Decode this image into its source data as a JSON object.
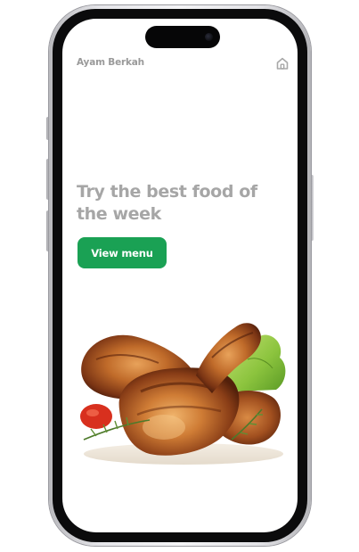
{
  "app": {
    "brand": "Ayam Berkah",
    "home_icon": "home-icon"
  },
  "hero": {
    "headline": "Try the best food of the week",
    "cta_label": "View menu",
    "image": "roasted-chicken-drumsticks"
  },
  "colors": {
    "accent": "#1aa154",
    "headline": "#a6a6a6",
    "brand_text": "#9a9a9a",
    "background": "#ffffff"
  }
}
